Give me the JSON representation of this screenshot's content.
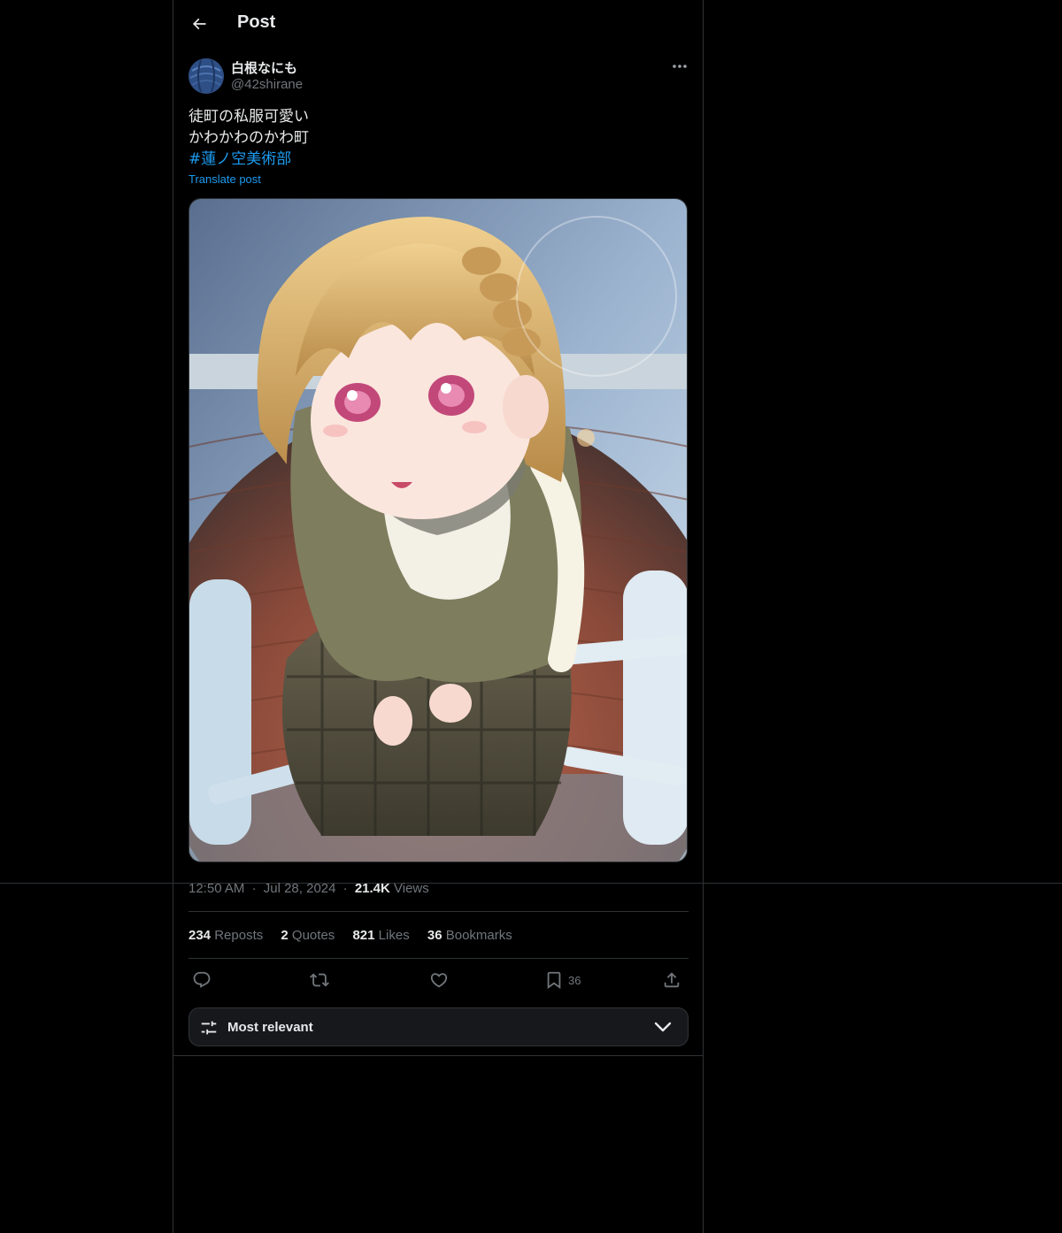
{
  "header": {
    "title": "Post"
  },
  "author": {
    "display_name": "白根なにも",
    "handle": "@42shirane"
  },
  "tweet": {
    "lines": [
      "徒町の私服可愛い",
      "かわかわのかわ町"
    ],
    "hashtag": "#蓮ノ空美術部",
    "translate_label": "Translate post"
  },
  "meta": {
    "time": "12:50 AM",
    "sep1": "·",
    "date": "Jul 28, 2024",
    "sep2": "·",
    "views_count": "21.4K",
    "views_label": "Views"
  },
  "stats": [
    {
      "count": "234",
      "label": "Reposts"
    },
    {
      "count": "2",
      "label": "Quotes"
    },
    {
      "count": "821",
      "label": "Likes"
    },
    {
      "count": "36",
      "label": "Bookmarks"
    }
  ],
  "actions": {
    "reply_icon": "reply-icon",
    "repost_icon": "repost-icon",
    "like_icon": "heart-icon",
    "bookmark_icon": "bookmark-icon",
    "bookmark_count": "36",
    "share_icon": "share-icon"
  },
  "sort": {
    "label": "Most relevant"
  },
  "colors": {
    "background": "#000000",
    "text": "#e7e9ea",
    "muted": "#71767b",
    "accent": "#1d9bf0",
    "border": "#2f3336"
  }
}
